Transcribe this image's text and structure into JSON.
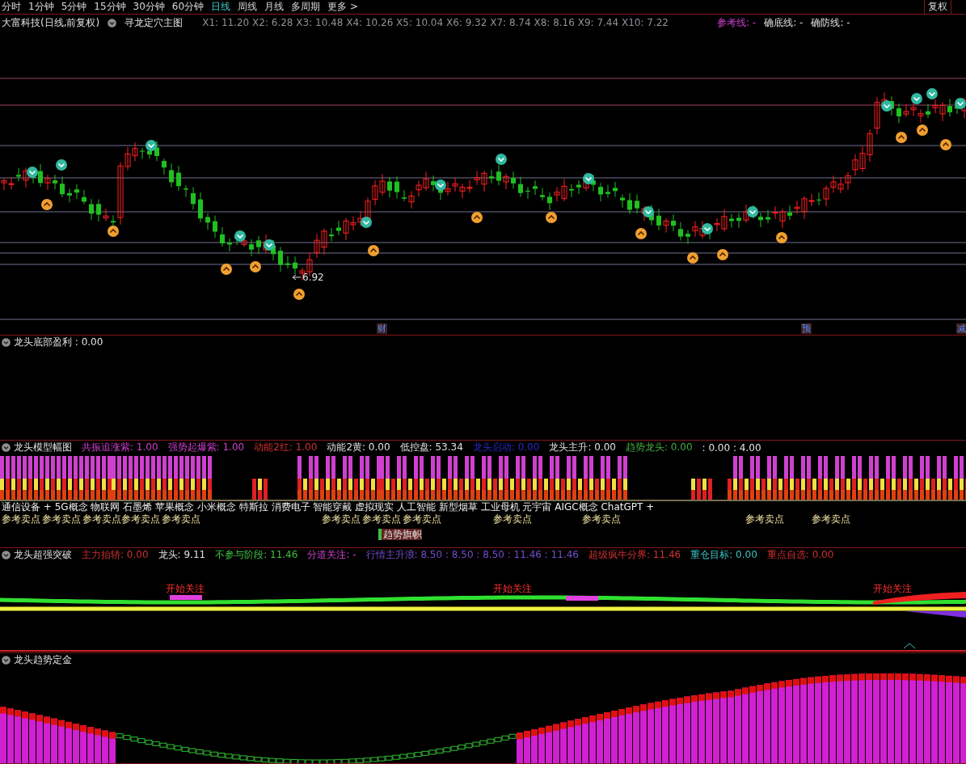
{
  "menu": {
    "tabs": [
      {
        "label": "分时",
        "selected": false
      },
      {
        "label": "1分钟",
        "selected": false
      },
      {
        "label": "5分钟",
        "selected": false
      },
      {
        "label": "15分钟",
        "selected": false
      },
      {
        "label": "30分钟",
        "selected": false
      },
      {
        "label": "60分钟",
        "selected": false
      },
      {
        "label": "日线",
        "selected": true
      },
      {
        "label": "周线",
        "selected": false
      },
      {
        "label": "月线",
        "selected": false
      },
      {
        "label": "多周期",
        "selected": false
      },
      {
        "label": "更多 >",
        "selected": false
      }
    ],
    "right_button": "复权"
  },
  "main": {
    "title": "大富科技(日线,前复权)",
    "indicator": "寻龙定穴主图",
    "values": "X1: 11.20 X2: 6.28 X3: 10.48 X4: 10.26 X5: 10.04 X6: 9.32 X7: 8.74 X8: 8.16 X9: 7.44 X10: 7.22",
    "refs": [
      {
        "label": "参考线: -",
        "color": "#d040d0"
      },
      {
        "label": "确底线: -",
        "color": "#e0e0e0"
      },
      {
        "label": "确防线: -",
        "color": "#e0e0e0"
      }
    ],
    "low_label": "6.92",
    "event_marks": [
      "财",
      "预",
      "减"
    ]
  },
  "panels": [
    {
      "kind": "empty",
      "title": "龙头底部盈利 : 0.00"
    },
    {
      "kind": "stripes",
      "title": "龙头模型幅图",
      "fields": [
        {
          "label": "共振追涨紫: 1.00",
          "color": "#d040d0"
        },
        {
          "label": "强势起爆紫: 1.00",
          "color": "#d040d0"
        },
        {
          "label": "动能2红: 1.00",
          "color": "#d03030"
        },
        {
          "label": "动能2黄: 0.00",
          "color": "#e0e0e0"
        },
        {
          "label": "低控盘: 53.34",
          "color": "#e0e0e0"
        },
        {
          "label": "龙头启动: 0.00",
          "color": "#2828c8"
        },
        {
          "label": "龙头主升: 0.00",
          "color": "#e0e0e0"
        },
        {
          "label": "趋势龙头: 0.00",
          "color": "#40b040"
        },
        {
          "label": ": 0.00 : 4.00",
          "color": "#e0e0e0"
        }
      ],
      "concepts": "通信设备 + 5G概念 物联网 石墨烯 苹果概念 小米概念 特斯拉 消费电子 智能穿戴 虚拟现实 人工智能 新型烟草 工业母机 元宇宙 AIGC概念 ChatGPT +",
      "sell_points": [
        "参考卖点",
        "参考卖点",
        "参考卖点",
        "参考卖点",
        "参考卖点",
        "参考卖点",
        "参考卖点",
        "参考卖点",
        "参考卖点",
        "参考卖点",
        "参考卖点",
        "参考卖点"
      ],
      "flag": "趋势旗帜"
    },
    {
      "kind": "bands",
      "title": "龙头超强突破",
      "fields": [
        {
          "label": "主力抬轿: 0.00",
          "color": "#d03030"
        },
        {
          "label": "龙头: 9.11",
          "color": "#e0e0e0"
        },
        {
          "label": "不参与阶段: 11.46",
          "color": "#40c040"
        },
        {
          "label": "分道关注: -",
          "color": "#d040d0"
        },
        {
          "label": "行情主升浪: 8.50 : 8.50 : 8.50 : 11.46 : 11.46",
          "color": "#7050d0"
        },
        {
          "label": "超级疯牛分界: 11.46",
          "color": "#d03030"
        },
        {
          "label": "重仓目标: 0.00",
          "color": "#40c0c0"
        },
        {
          "label": "重点自选: 0.00",
          "color": "#d03030"
        }
      ],
      "notes": [
        "开始关注",
        "开始关注",
        "开始关注"
      ]
    },
    {
      "kind": "histogram",
      "title": "龙头趋势定金"
    }
  ]
}
